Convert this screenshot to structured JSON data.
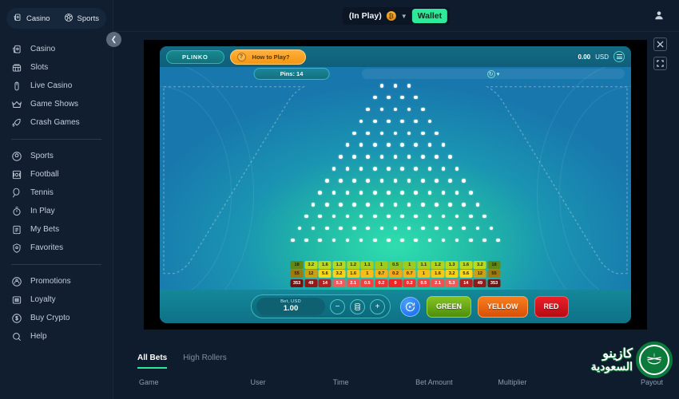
{
  "sidebar": {
    "segments": [
      {
        "label": "Casino",
        "icon": "cards-icon"
      },
      {
        "label": "Sports",
        "icon": "ball-icon"
      }
    ],
    "group1": [
      {
        "label": "Casino",
        "icon": "cards-icon"
      },
      {
        "label": "Slots",
        "icon": "slots-icon"
      },
      {
        "label": "Live Casino",
        "icon": "live-casino-icon"
      },
      {
        "label": "Game Shows",
        "icon": "crown-icon"
      },
      {
        "label": "Crash Games",
        "icon": "rocket-icon"
      }
    ],
    "group2": [
      {
        "label": "Sports",
        "icon": "ball-icon"
      },
      {
        "label": "Football",
        "icon": "football-field-icon"
      },
      {
        "label": "Tennis",
        "icon": "tennis-racket-icon"
      },
      {
        "label": "In Play",
        "icon": "stopwatch-icon"
      },
      {
        "label": "My Bets",
        "icon": "ticket-icon"
      },
      {
        "label": "Favorites",
        "icon": "shield-star-icon"
      }
    ],
    "group3": [
      {
        "label": "Promotions",
        "icon": "gift-icon"
      },
      {
        "label": "Loyalty",
        "icon": "loyalty-card-icon"
      },
      {
        "label": "Buy Crypto",
        "icon": "dollar-coin-icon"
      },
      {
        "label": "Help",
        "icon": "search-icon"
      }
    ],
    "collapse_icon": "chevron-left-icon"
  },
  "topbar": {
    "in_play_label": "(In Play)",
    "coin_symbol": "₿",
    "chevron_icon": "chevron-down-icon",
    "wallet_label": "Wallet",
    "profile_icon": "user-icon"
  },
  "side_actions": [
    {
      "icon": "close-icon",
      "glyph": "✕"
    },
    {
      "icon": "fullscreen-icon",
      "glyph": "⛶"
    }
  ],
  "game": {
    "title": "PLINKO",
    "how_to_play": "How to Play?",
    "question_glyph": "?",
    "balance_amount": "0.00",
    "balance_currency": "USD",
    "menu_icon": "hamburger-icon",
    "pins_label": "Pins: 14",
    "refresh_icon": "refresh-icon",
    "pin_rows": [
      3,
      4,
      5,
      6,
      7,
      8,
      9,
      10,
      11,
      12,
      13,
      14,
      15,
      16
    ],
    "multipliers": {
      "green": [
        "18",
        "3.2",
        "1.6",
        "1.3",
        "1.2",
        "1.1",
        "1",
        "0.5",
        "1",
        "1.1",
        "1.2",
        "1.3",
        "1.6",
        "3.2",
        "18"
      ],
      "yellow": [
        "55",
        "12",
        "5.6",
        "3.2",
        "1.6",
        "1",
        "0.7",
        "0.2",
        "0.7",
        "1",
        "1.6",
        "3.2",
        "5.6",
        "12",
        "55"
      ],
      "red": [
        "353",
        "49",
        "14",
        "5.3",
        "2.1",
        "0.5",
        "0.2",
        "0",
        "0.2",
        "0.5",
        "2.1",
        "5.3",
        "14",
        "49",
        "353"
      ]
    },
    "multiplier_colors": {
      "green_scale": [
        "#8fc520",
        "#9ecb1e",
        "#a8d01d",
        "#b0d41c",
        "#b6d71b",
        "#b9d91b",
        "#bcda1a",
        "#5e8a12"
      ],
      "yellow_scale": [
        "#f0a81c",
        "#f2b41c",
        "#f4bf1b",
        "#f5c81a",
        "#f7d11a",
        "#f8d819",
        "#c9a016",
        "#9c7a12"
      ],
      "red_scale": [
        "#ef2626",
        "#f23232",
        "#f44040",
        "#f55050",
        "#f05b5b",
        "#b32222",
        "#8e1a1a",
        "#6f1414"
      ]
    },
    "controls": {
      "bet_label": "Bet, USD",
      "bet_value": "1.00",
      "minus": "−",
      "plus": "+",
      "stack_icon": "chips-icon",
      "auto_icon": "auto-play-icon",
      "risk_buttons": [
        {
          "label": "GREEN",
          "color": "#6aa614"
        },
        {
          "label": "YELLOW",
          "color": "#e26410"
        },
        {
          "label": "RED",
          "color": "#d11620"
        }
      ]
    }
  },
  "bets": {
    "tabs": [
      {
        "label": "All Bets",
        "active": true
      },
      {
        "label": "High Rollers",
        "active": false
      }
    ],
    "columns": [
      "Game",
      "User",
      "Time",
      "Bet Amount",
      "Multiplier",
      "Payout"
    ]
  },
  "logo": {
    "line1": "كازينو",
    "line2": "السعودية",
    "emblem": "saudi-emblem-icon",
    "color": "#0b7a3b"
  }
}
